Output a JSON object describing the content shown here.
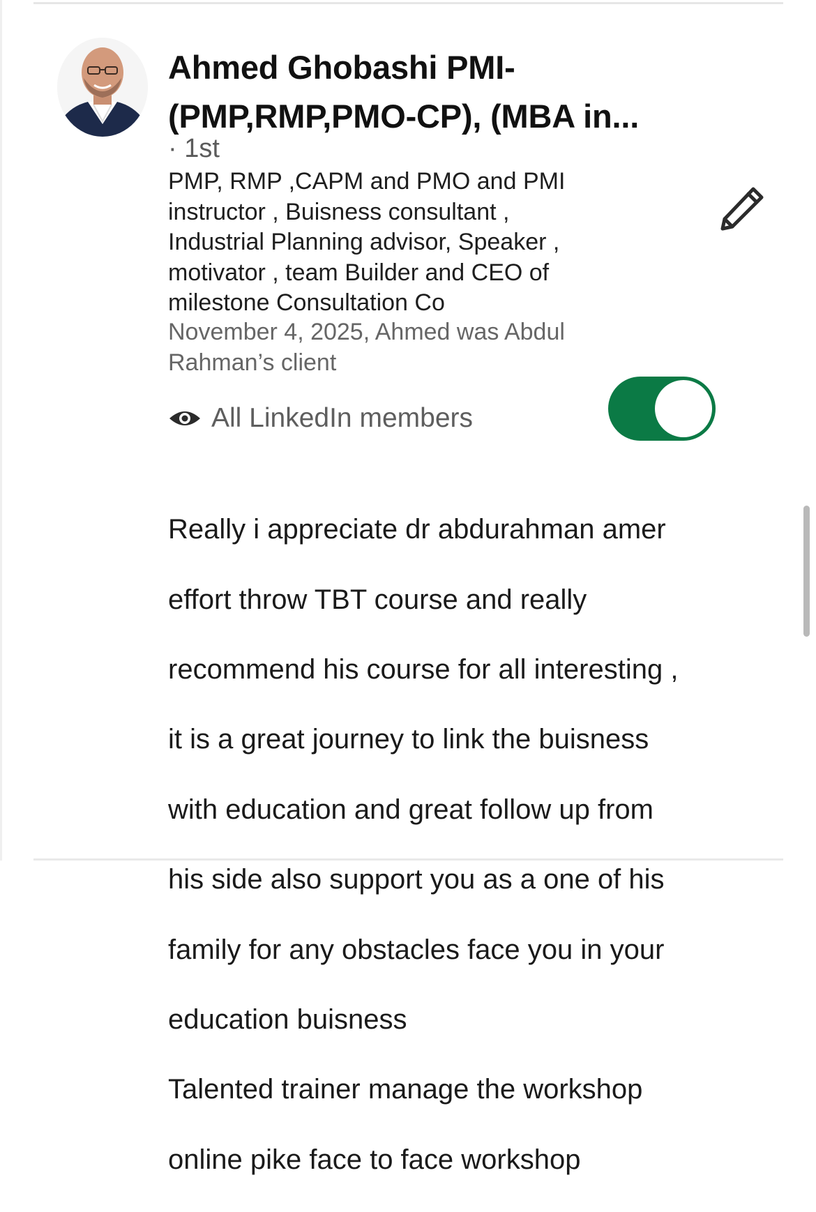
{
  "recommender": {
    "name": "Ahmed Ghobashi PMI-(PMP,RMP,PMO-CP), (MBA in...",
    "name_line1": "Ahmed Ghobashi PMI-",
    "name_line2": "(PMP,RMP,PMO-CP), (MBA in...",
    "degree": "· 1st",
    "headline_lines": [
      "PMP, RMP ,CAPM and PMO and PMI",
      "instructor , Buisness consultant ,",
      "Industrial Planning advisor, Speaker ,",
      "motivator , team Builder and CEO of",
      "milestone Consultation Co"
    ],
    "relationship_lines": [
      "November 4, 2025, Ahmed was Abdul",
      "Rahman’s client"
    ]
  },
  "visibility": {
    "icon": "eye-icon",
    "label": "All LinkedIn members",
    "toggle_on": true
  },
  "edit_icon": "pencil-icon",
  "recommendation_lines": [
    "Really i appreciate dr abdurahman amer",
    "effort throw TBT course and really",
    "recommend his course for all interesting ,",
    "it is a great journey to link the buisness",
    "with education and great follow up from",
    "his side also support you as a one of his",
    "family for any obstacles face you in your",
    "education buisness",
    "Talented trainer manage the workshop",
    "online pike face to face workshop"
  ],
  "colors": {
    "toggle_on": "#0b7a45",
    "meta_text": "#666666"
  }
}
